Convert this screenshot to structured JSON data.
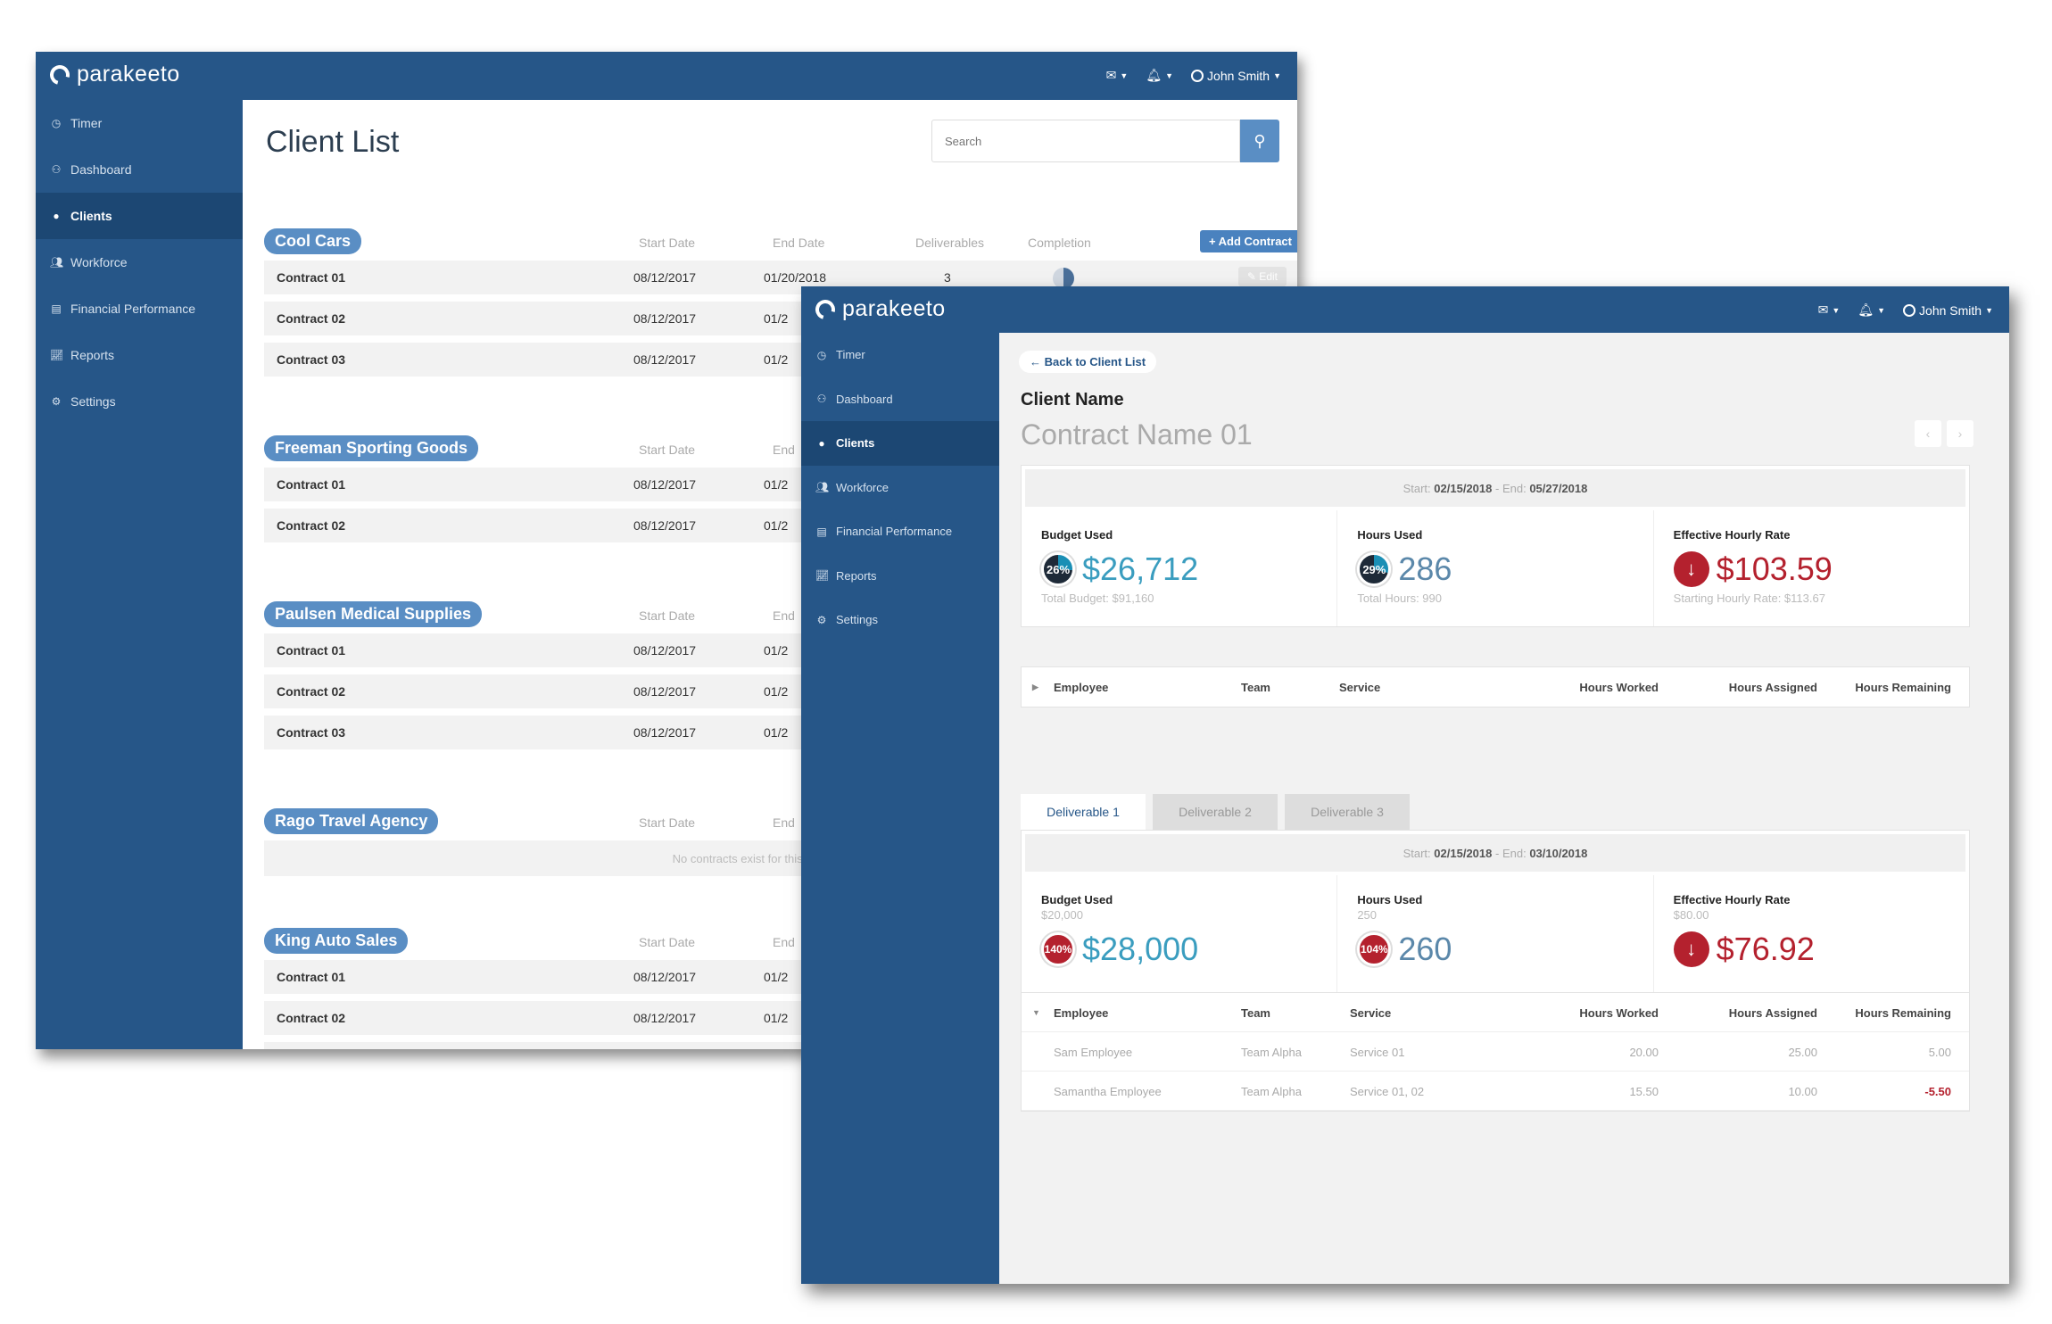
{
  "brand": "parakeeto",
  "user": "John Smith",
  "nav": [
    "Timer",
    "Dashboard",
    "Clients",
    "Workforce",
    "Financial Performance",
    "Reports",
    "Settings"
  ],
  "nav_icons": [
    "clock-icon",
    "dashboard-icon",
    "user-icon",
    "workforce-icon",
    "financial-icon",
    "reports-icon",
    "settings-icon"
  ],
  "list": {
    "title": "Client List",
    "search_placeholder": "Search",
    "add_contract": "+ Add Contract",
    "edit": "✎ Edit",
    "cols": {
      "start": "Start Date",
      "end": "End Date",
      "deliverables": "Deliverables",
      "completion": "Completion",
      "end_short": "End"
    },
    "clients": [
      {
        "name": "Cool Cars",
        "contracts": [
          {
            "name": "Contract 01",
            "start": "08/12/2017",
            "end": "01/20/2018",
            "deliverables": "3"
          },
          {
            "name": "Contract 02",
            "start": "08/12/2017",
            "end": "01/2"
          },
          {
            "name": "Contract 03",
            "start": "08/12/2017",
            "end": "01/2"
          }
        ]
      },
      {
        "name": "Freeman Sporting Goods",
        "contracts": [
          {
            "name": "Contract 01",
            "start": "08/12/2017",
            "end": "01/2"
          },
          {
            "name": "Contract 02",
            "start": "08/12/2017",
            "end": "01/2"
          }
        ]
      },
      {
        "name": "Paulsen Medical Supplies",
        "contracts": [
          {
            "name": "Contract 01",
            "start": "08/12/2017",
            "end": "01/2"
          },
          {
            "name": "Contract 02",
            "start": "08/12/2017",
            "end": "01/2"
          },
          {
            "name": "Contract 03",
            "start": "08/12/2017",
            "end": "01/2"
          }
        ]
      },
      {
        "name": "Rago Travel Agency",
        "empty": "No contracts exist for this client. Click \"Add",
        "contracts": []
      },
      {
        "name": "King Auto Sales",
        "contracts": [
          {
            "name": "Contract 01",
            "start": "08/12/2017",
            "end": "01/2"
          },
          {
            "name": "Contract 02",
            "start": "08/12/2017",
            "end": "01/2"
          },
          {
            "name": "Contract 03",
            "start": "08/12/2017",
            "end": "01/2"
          }
        ]
      }
    ]
  },
  "detail": {
    "back": "Back to Client List",
    "client_name": "Client Name",
    "contract_name": "Contract Name 01",
    "contract_dates": {
      "start_label": "Start:",
      "start": "02/15/2018",
      "end_label": "- End:",
      "end": "05/27/2018"
    },
    "stats": {
      "budget": {
        "label": "Budget Used",
        "pct": "26%",
        "value": "$26,712",
        "foot": "Total Budget: $91,160"
      },
      "hours": {
        "label": "Hours Used",
        "pct": "29%",
        "value": "286",
        "foot": "Total Hours: 990"
      },
      "rate": {
        "label": "Effective Hourly Rate",
        "value": "$103.59",
        "foot": "Starting Hourly Rate: $113.67"
      }
    },
    "table_cols": [
      "Employee",
      "Team",
      "Service",
      "Hours Worked",
      "Hours Assigned",
      "Hours Remaining"
    ],
    "tabs": [
      "Deliverable 1",
      "Deliverable 2",
      "Deliverable 3"
    ],
    "deliv_dates": {
      "start_label": "Start:",
      "start": "02/15/2018",
      "end_label": "- End:",
      "end": "03/10/2018"
    },
    "dstats": {
      "budget": {
        "label": "Budget Used",
        "sub": "$20,000",
        "pct": "140%",
        "value": "$28,000"
      },
      "hours": {
        "label": "Hours Used",
        "sub": "250",
        "pct": "104%",
        "value": "260"
      },
      "rate": {
        "label": "Effective Hourly Rate",
        "sub": "$80.00",
        "value": "$76.92"
      }
    },
    "rows": [
      {
        "employee": "Sam Employee",
        "team": "Team Alpha",
        "service": "Service 01",
        "worked": "20.00",
        "assigned": "25.00",
        "remaining": "5.00"
      },
      {
        "employee": "Samantha Employee",
        "team": "Team Alpha",
        "service": "Service 01, 02",
        "worked": "15.50",
        "assigned": "10.00",
        "remaining": "-5.50"
      }
    ]
  }
}
